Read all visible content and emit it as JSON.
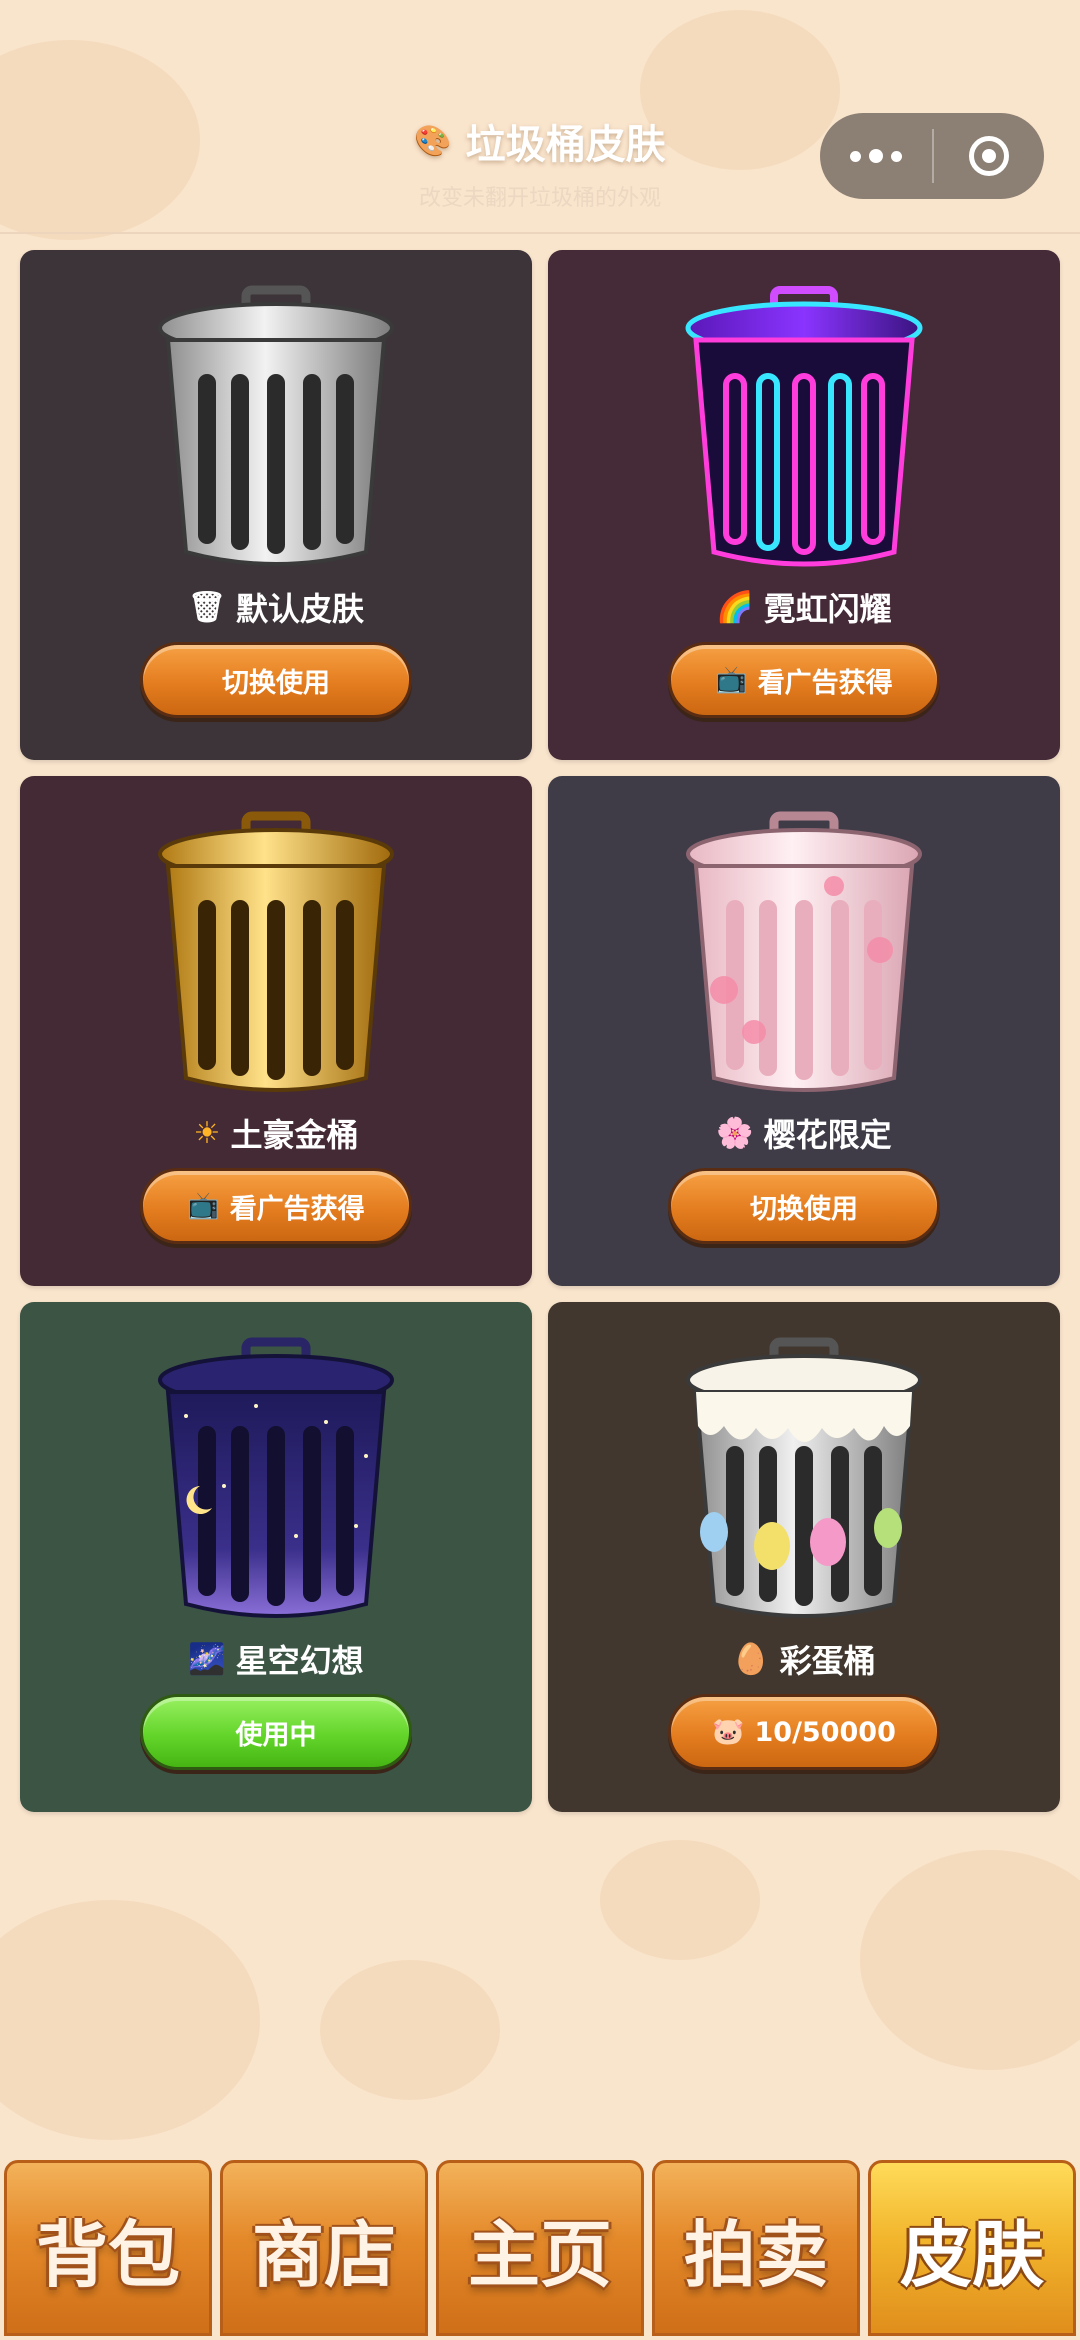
{
  "header": {
    "title": "垃圾桶皮肤",
    "title_icon": "palette-icon",
    "subtitle": "改变未翻开垃圾桶的外观"
  },
  "skins": [
    {
      "name": "默认皮肤",
      "emoji": "🗑",
      "button": "切换使用",
      "button_icon": "",
      "status": "switch",
      "bg": "#3c3438"
    },
    {
      "name": "霓虹闪耀",
      "emoji": "🌈",
      "button": "看广告获得",
      "button_icon": "📺",
      "status": "ad",
      "bg": "#452a38"
    },
    {
      "name": "土豪金桶",
      "emoji": "☀",
      "button": "看广告获得",
      "button_icon": "📺",
      "status": "ad",
      "bg": "#442a34"
    },
    {
      "name": "樱花限定",
      "emoji": "🌸",
      "button": "切换使用",
      "button_icon": "",
      "status": "switch",
      "bg": "#3f3c48"
    },
    {
      "name": "星空幻想",
      "emoji": "🌌",
      "button": "使用中",
      "button_icon": "",
      "status": "in-use",
      "bg": "#3b5444"
    },
    {
      "name": "彩蛋桶",
      "emoji": "🥚",
      "button": "10/50000",
      "button_icon": "🐷",
      "status": "locked",
      "bg": "#42372e"
    }
  ],
  "nav": [
    {
      "label": "背包",
      "active": false
    },
    {
      "label": "商店",
      "active": false
    },
    {
      "label": "主页",
      "active": false
    },
    {
      "label": "拍卖",
      "active": false
    },
    {
      "label": "皮肤",
      "active": true
    }
  ]
}
